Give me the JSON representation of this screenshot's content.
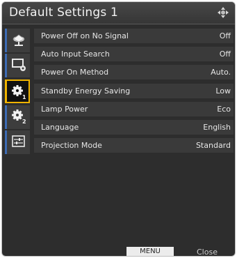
{
  "window": {
    "title": "Default Settings 1"
  },
  "sidebar": {
    "items": [
      {
        "icon": "picture-settings-icon",
        "active": false
      },
      {
        "icon": "screen-settings-icon",
        "active": false
      },
      {
        "icon": "default-settings-1-icon",
        "active": true
      },
      {
        "icon": "default-settings-2-icon",
        "active": false
      },
      {
        "icon": "advanced-settings-icon",
        "active": false
      }
    ]
  },
  "settings": [
    {
      "label": "Power Off on No Signal",
      "value": "Off"
    },
    {
      "label": "Auto Input Search",
      "value": "Off"
    },
    {
      "label": "Power On Method",
      "value": "Auto."
    },
    {
      "label": "Standby Energy Saving",
      "value": "Low"
    },
    {
      "label": "Lamp Power",
      "value": "Eco"
    },
    {
      "label": "Language",
      "value": "English"
    },
    {
      "label": "Projection Mode",
      "value": "Standard"
    }
  ],
  "footer": {
    "menu_key": "MENU",
    "close_label": "Close"
  },
  "colors": {
    "background": "#2d2d2d",
    "row": "#3a3a3a",
    "accent_active": "#f0b400",
    "accent_sidebar": "#3d6bb4",
    "text": "#e6e6e6"
  }
}
